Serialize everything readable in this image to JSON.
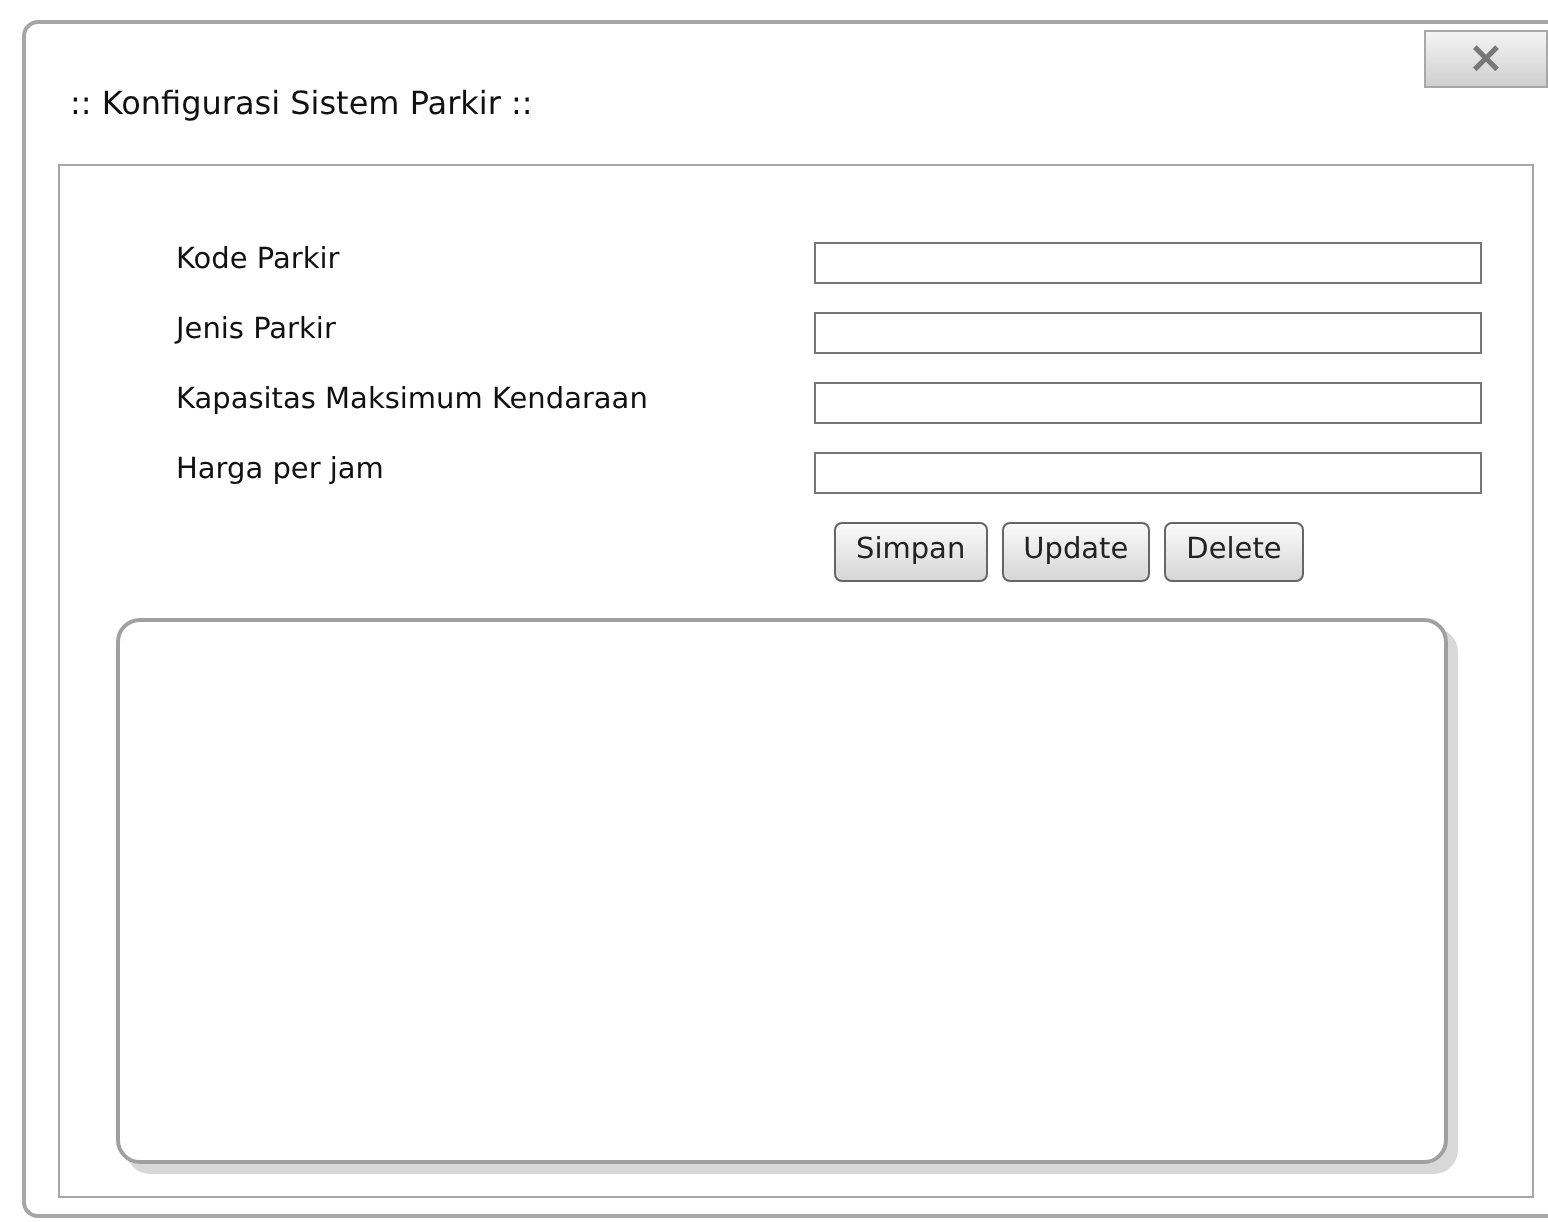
{
  "window": {
    "title": ":: Konfigurasi Sistem Parkir ::",
    "close": "×"
  },
  "fields": [
    {
      "label": "Kode Parkir"
    },
    {
      "label": "Jenis Parkir"
    },
    {
      "label": "Kapasitas Maksimum Kendaraan"
    },
    {
      "label": "Harga per jam"
    }
  ],
  "buttons": [
    "Simpan",
    "Update",
    "Delete"
  ]
}
